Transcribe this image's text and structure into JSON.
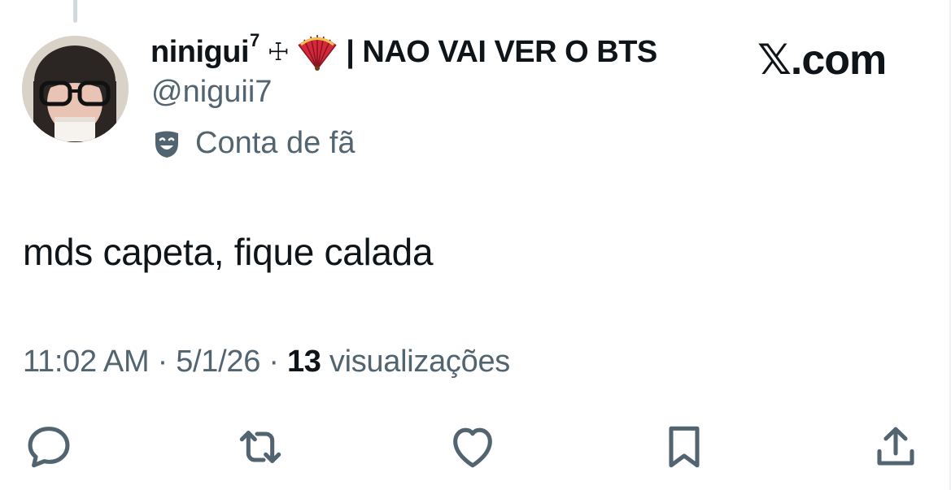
{
  "author": {
    "display_name": "ninigui",
    "superscript": "7",
    "cross_glyph": "☩",
    "fan_emoji_icon": "folding-fan-icon",
    "tagline": "| NAO VAI VER O BTS",
    "handle": "@niguii7",
    "label": "Conta de fã",
    "label_icon": "theater-masks-icon"
  },
  "brand": {
    "logo_letter": "𝕏",
    "domain": ".com"
  },
  "tweet": {
    "text": "mds capeta, fique calada"
  },
  "meta": {
    "time": "11:02 AM",
    "separator1": " · ",
    "date": "5/1/26",
    "separator2": " · ",
    "views_count": "13",
    "views_label": " visualizações"
  },
  "actions": {
    "icons": [
      "reply-icon",
      "retweet-icon",
      "like-icon",
      "bookmark-icon",
      "share-icon"
    ]
  },
  "colors": {
    "primary_text": "#0f1419",
    "secondary_text": "#536471",
    "icon": "#536471",
    "fan_red": "#d6283b"
  }
}
